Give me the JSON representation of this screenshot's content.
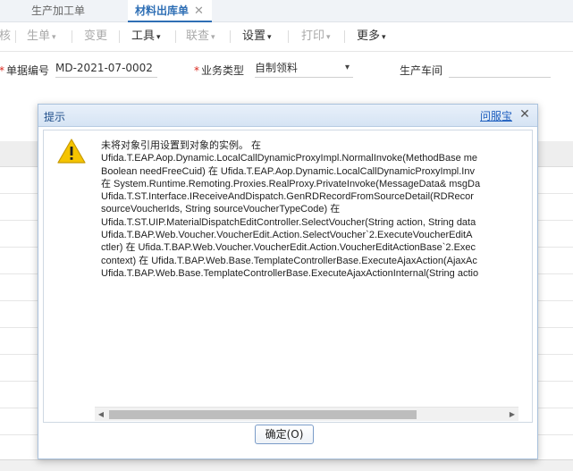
{
  "tabs": [
    {
      "label": "生产加工单"
    },
    {
      "label": "材料出库单",
      "close": "✕"
    }
  ],
  "toolbar": {
    "audit_fragment": "核",
    "gen": "生单",
    "change": "变更",
    "tools": "工具",
    "linkquery": "联查",
    "settings": "设置",
    "print": "打印",
    "more": "更多",
    "caret": "▾"
  },
  "form": {
    "doc_no_label": "单据编号",
    "doc_no_value": "MD-2021-07-0002",
    "biz_type_label": "业务类型",
    "biz_type_value": "自制领料",
    "workshop_label": "生产车间",
    "workshop_value": "",
    "required_mark": "*"
  },
  "dialog": {
    "title": "提示",
    "service_link": "问服宝",
    "close": "✕",
    "message_lines": [
      "未将对象引用设置到对象的实例。 在",
      "Ufida.T.EAP.Aop.Dynamic.LocalCallDynamicProxyImpl.NormalInvoke(MethodBase me",
      "Boolean needFreeCuid) 在 Ufida.T.EAP.Aop.Dynamic.LocalCallDynamicProxyImpl.Inv",
      "在 System.Runtime.Remoting.Proxies.RealProxy.PrivateInvoke(MessageData& msgDa",
      "Ufida.T.ST.Interface.IReceiveAndDispatch.GenRDRecordFromSourceDetail(RDRecor",
      "sourceVoucherIds, String sourceVoucherTypeCode) 在",
      "Ufida.T.ST.UIP.MaterialDispatchEditController.SelectVoucher(String action, String data",
      "Ufida.T.BAP.Web.Voucher.VoucherEdit.Action.SelectVoucher`2.ExecuteVoucherEditA",
      "ctler) 在 Ufida.T.BAP.Web.Voucher.VoucherEdit.Action.VoucherEditActionBase`2.Exec",
      "context) 在 Ufida.T.BAP.Web.Base.TemplateControllerBase.ExecuteAjaxAction(AjaxAc",
      "Ufida.T.BAP.Web.Base.TemplateControllerBase.ExecuteAjaxActionInternal(String actio"
    ],
    "ok_button": "确定(O)",
    "warning_color": "#f5c400"
  }
}
